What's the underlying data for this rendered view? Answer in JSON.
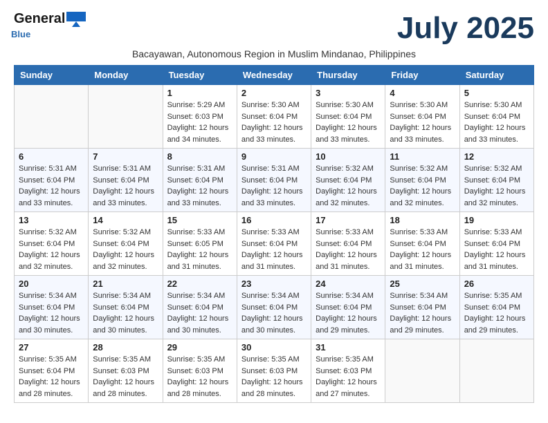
{
  "header": {
    "logo_general": "General",
    "logo_blue": "Blue",
    "month_year": "July 2025",
    "subtitle": "Bacayawan, Autonomous Region in Muslim Mindanao, Philippines"
  },
  "days_of_week": [
    "Sunday",
    "Monday",
    "Tuesday",
    "Wednesday",
    "Thursday",
    "Friday",
    "Saturday"
  ],
  "weeks": [
    [
      {
        "day": "",
        "info": ""
      },
      {
        "day": "",
        "info": ""
      },
      {
        "day": "1",
        "info": "Sunrise: 5:29 AM\nSunset: 6:03 PM\nDaylight: 12 hours and 34 minutes."
      },
      {
        "day": "2",
        "info": "Sunrise: 5:30 AM\nSunset: 6:04 PM\nDaylight: 12 hours and 33 minutes."
      },
      {
        "day": "3",
        "info": "Sunrise: 5:30 AM\nSunset: 6:04 PM\nDaylight: 12 hours and 33 minutes."
      },
      {
        "day": "4",
        "info": "Sunrise: 5:30 AM\nSunset: 6:04 PM\nDaylight: 12 hours and 33 minutes."
      },
      {
        "day": "5",
        "info": "Sunrise: 5:30 AM\nSunset: 6:04 PM\nDaylight: 12 hours and 33 minutes."
      }
    ],
    [
      {
        "day": "6",
        "info": "Sunrise: 5:31 AM\nSunset: 6:04 PM\nDaylight: 12 hours and 33 minutes."
      },
      {
        "day": "7",
        "info": "Sunrise: 5:31 AM\nSunset: 6:04 PM\nDaylight: 12 hours and 33 minutes."
      },
      {
        "day": "8",
        "info": "Sunrise: 5:31 AM\nSunset: 6:04 PM\nDaylight: 12 hours and 33 minutes."
      },
      {
        "day": "9",
        "info": "Sunrise: 5:31 AM\nSunset: 6:04 PM\nDaylight: 12 hours and 33 minutes."
      },
      {
        "day": "10",
        "info": "Sunrise: 5:32 AM\nSunset: 6:04 PM\nDaylight: 12 hours and 32 minutes."
      },
      {
        "day": "11",
        "info": "Sunrise: 5:32 AM\nSunset: 6:04 PM\nDaylight: 12 hours and 32 minutes."
      },
      {
        "day": "12",
        "info": "Sunrise: 5:32 AM\nSunset: 6:04 PM\nDaylight: 12 hours and 32 minutes."
      }
    ],
    [
      {
        "day": "13",
        "info": "Sunrise: 5:32 AM\nSunset: 6:04 PM\nDaylight: 12 hours and 32 minutes."
      },
      {
        "day": "14",
        "info": "Sunrise: 5:32 AM\nSunset: 6:04 PM\nDaylight: 12 hours and 32 minutes."
      },
      {
        "day": "15",
        "info": "Sunrise: 5:33 AM\nSunset: 6:05 PM\nDaylight: 12 hours and 31 minutes."
      },
      {
        "day": "16",
        "info": "Sunrise: 5:33 AM\nSunset: 6:04 PM\nDaylight: 12 hours and 31 minutes."
      },
      {
        "day": "17",
        "info": "Sunrise: 5:33 AM\nSunset: 6:04 PM\nDaylight: 12 hours and 31 minutes."
      },
      {
        "day": "18",
        "info": "Sunrise: 5:33 AM\nSunset: 6:04 PM\nDaylight: 12 hours and 31 minutes."
      },
      {
        "day": "19",
        "info": "Sunrise: 5:33 AM\nSunset: 6:04 PM\nDaylight: 12 hours and 31 minutes."
      }
    ],
    [
      {
        "day": "20",
        "info": "Sunrise: 5:34 AM\nSunset: 6:04 PM\nDaylight: 12 hours and 30 minutes."
      },
      {
        "day": "21",
        "info": "Sunrise: 5:34 AM\nSunset: 6:04 PM\nDaylight: 12 hours and 30 minutes."
      },
      {
        "day": "22",
        "info": "Sunrise: 5:34 AM\nSunset: 6:04 PM\nDaylight: 12 hours and 30 minutes."
      },
      {
        "day": "23",
        "info": "Sunrise: 5:34 AM\nSunset: 6:04 PM\nDaylight: 12 hours and 30 minutes."
      },
      {
        "day": "24",
        "info": "Sunrise: 5:34 AM\nSunset: 6:04 PM\nDaylight: 12 hours and 29 minutes."
      },
      {
        "day": "25",
        "info": "Sunrise: 5:34 AM\nSunset: 6:04 PM\nDaylight: 12 hours and 29 minutes."
      },
      {
        "day": "26",
        "info": "Sunrise: 5:35 AM\nSunset: 6:04 PM\nDaylight: 12 hours and 29 minutes."
      }
    ],
    [
      {
        "day": "27",
        "info": "Sunrise: 5:35 AM\nSunset: 6:04 PM\nDaylight: 12 hours and 28 minutes."
      },
      {
        "day": "28",
        "info": "Sunrise: 5:35 AM\nSunset: 6:03 PM\nDaylight: 12 hours and 28 minutes."
      },
      {
        "day": "29",
        "info": "Sunrise: 5:35 AM\nSunset: 6:03 PM\nDaylight: 12 hours and 28 minutes."
      },
      {
        "day": "30",
        "info": "Sunrise: 5:35 AM\nSunset: 6:03 PM\nDaylight: 12 hours and 28 minutes."
      },
      {
        "day": "31",
        "info": "Sunrise: 5:35 AM\nSunset: 6:03 PM\nDaylight: 12 hours and 27 minutes."
      },
      {
        "day": "",
        "info": ""
      },
      {
        "day": "",
        "info": ""
      }
    ]
  ]
}
